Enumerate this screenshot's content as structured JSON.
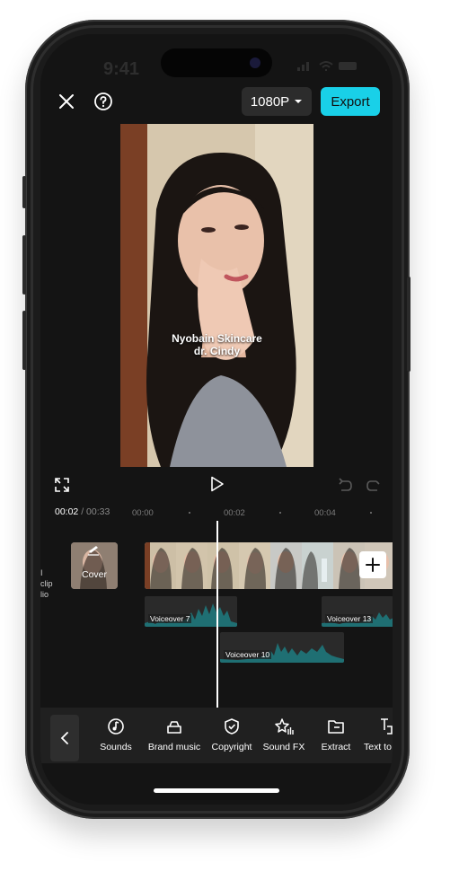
{
  "status": {
    "time": "9:41"
  },
  "header": {
    "resolution": "1080P",
    "export_label": "Export"
  },
  "preview": {
    "caption_line1": "Nyobain Skincare",
    "caption_line2": "dr. Cindy"
  },
  "timeline": {
    "current_time": "00:02",
    "total_time": "/ 00:33",
    "ruler": [
      "00:00",
      "00:02",
      "00:04"
    ],
    "side_label_line1": "clip",
    "side_label_line2": "lio",
    "cover_label": "Cover",
    "voiceovers": [
      "Voiceover 7",
      "Voiceover 13",
      "Voiceover 10"
    ]
  },
  "toolbar": {
    "items": [
      {
        "label": "Sounds",
        "icon": "music-note-icon"
      },
      {
        "label": "Brand music",
        "icon": "brand-music-icon"
      },
      {
        "label": "Copyright",
        "icon": "shield-check-icon"
      },
      {
        "label": "Sound FX",
        "icon": "star-waveform-icon"
      },
      {
        "label": "Extract",
        "icon": "folder-extract-icon"
      },
      {
        "label": "Text to",
        "icon": "text-to-speech-icon"
      }
    ]
  },
  "colors": {
    "accent": "#19d0e8",
    "waveform": "#1f6f73",
    "background": "#141414"
  }
}
